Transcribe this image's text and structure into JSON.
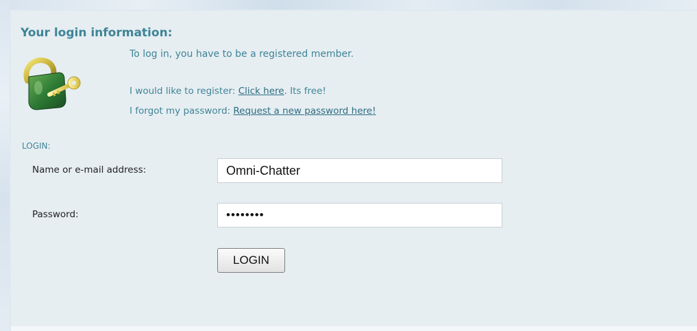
{
  "login_info": {
    "title": "Your login information:",
    "intro": "To log in, you have to be a registered member.",
    "register_prefix": "I would like to register: ",
    "register_link": "Click here",
    "register_suffix": ". Its free!",
    "forgot_prefix": "I forgot my password: ",
    "forgot_link": "Request a new password here!"
  },
  "login_form": {
    "section_label": "LOGIN:",
    "name_label": "Name or e-mail address:",
    "name_value": "Omni-Chatter",
    "password_label": "Password:",
    "password_value": "••••••••",
    "submit_label": "LOGIN"
  },
  "icons": {
    "lock": "padlock-with-key-icon"
  },
  "colors": {
    "accent": "#3f8496",
    "link": "#2d6c80",
    "panel_bg": "#e6eef2"
  }
}
